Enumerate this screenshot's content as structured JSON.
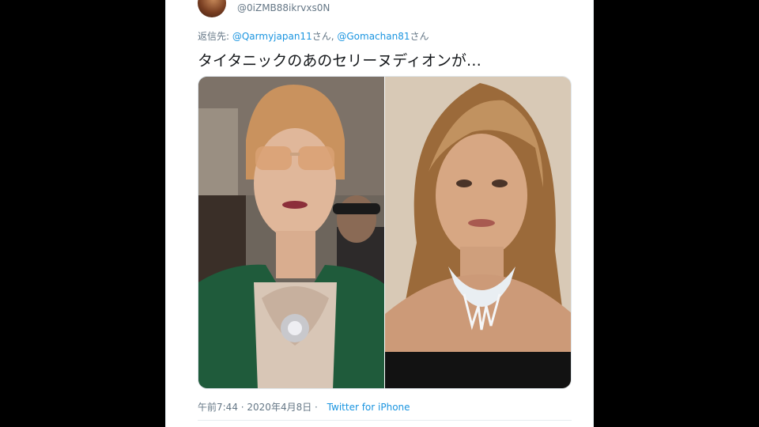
{
  "tweet": {
    "handle": "@0iZMB88ikrvxs0N",
    "reply_prefix": "返信先: ",
    "mentions": [
      "@Qarmyjapan11",
      "@Gomachan81"
    ],
    "mention_suffix": "さん",
    "separator": ", ",
    "text": "タイタニックのあのセリーヌディオンが…",
    "time": "午前7:44",
    "date": "2020年4月8日",
    "meta_separator": " · ",
    "source": "Twitter for iPhone"
  }
}
